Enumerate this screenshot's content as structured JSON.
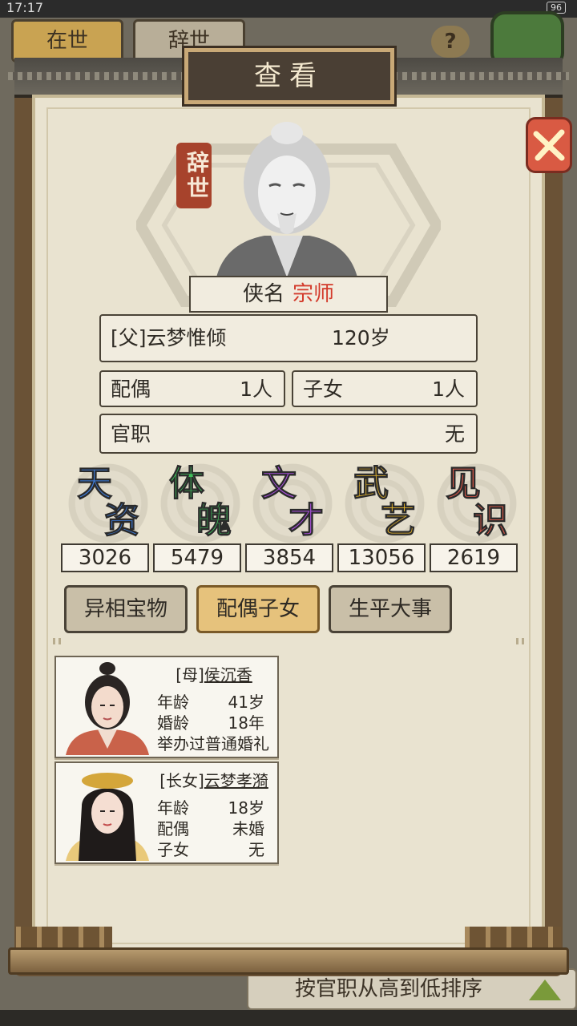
{
  "status_bar": {
    "time": "17:17",
    "battery": "96"
  },
  "background": {
    "tabs": [
      "在世",
      "辞世"
    ],
    "help": "?",
    "sort_label": "按官职从高到低排序"
  },
  "dialog": {
    "title": "查看",
    "seal": "辞世",
    "name_label": "侠名",
    "rank": "宗师",
    "father": {
      "name": "[父]云梦惟倾",
      "age": "120岁"
    },
    "spouse": {
      "label": "配偶",
      "value": "1人"
    },
    "children": {
      "label": "子女",
      "value": "1人"
    },
    "office": {
      "label": "官职",
      "value": "无"
    }
  },
  "stats": [
    {
      "c1": "天",
      "c2": "资",
      "value": "3026",
      "color": "#3e7fe0"
    },
    {
      "c1": "体",
      "c2": "魄",
      "value": "5479",
      "color": "#3fbf5a"
    },
    {
      "c1": "文",
      "c2": "才",
      "value": "3854",
      "color": "#a64fd6"
    },
    {
      "c1": "武",
      "c2": "艺",
      "value": "13056",
      "color": "#e3b22b"
    },
    {
      "c1": "见",
      "c2": "识",
      "value": "2619",
      "color": "#e25b4a"
    }
  ],
  "tabs": [
    "异相宝物",
    "配偶子女",
    "生平大事"
  ],
  "family": [
    {
      "tag": "[母]",
      "name": "侯沉香",
      "rows": [
        [
          "年龄",
          "41岁"
        ],
        [
          "婚龄",
          "18年"
        ]
      ],
      "note": "举办过普通婚礼"
    },
    {
      "tag": "[长女]",
      "name": "云梦孝漪",
      "rows": [
        [
          "年龄",
          "18岁"
        ],
        [
          "配偶",
          "未婚"
        ],
        [
          "子女",
          "无"
        ]
      ]
    }
  ]
}
